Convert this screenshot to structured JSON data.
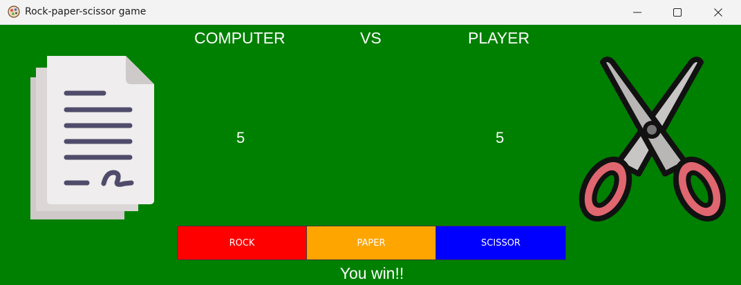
{
  "window": {
    "title": "Rock-paper-scissor game",
    "background": "#008000"
  },
  "headings": {
    "computer": "COMPUTER",
    "vs": "VS",
    "player": "PLAYER"
  },
  "scores": {
    "computer": "5",
    "player": "5"
  },
  "computer_choice": {
    "icon": "paper-icon"
  },
  "player_choice": {
    "icon": "scissor-icon"
  },
  "buttons": [
    {
      "label": "ROCK",
      "color": "#ff0000"
    },
    {
      "label": "PAPER",
      "color": "#ffa500"
    },
    {
      "label": "SCISSOR",
      "color": "#0000ff"
    }
  ],
  "result": "You win!!"
}
